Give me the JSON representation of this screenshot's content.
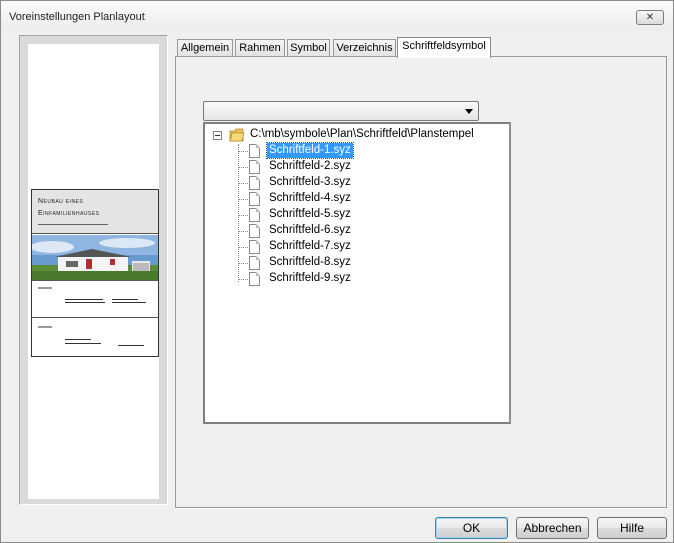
{
  "window": {
    "title": "Voreinstellungen Planlayout",
    "close_label": "✕"
  },
  "preview": {
    "stamp_title_line1": "Neubau eines",
    "stamp_title_line2": "Einfamilienhauses"
  },
  "tabs": [
    {
      "label": "Allgemein"
    },
    {
      "label": "Rahmen"
    },
    {
      "label": "Symbol"
    },
    {
      "label": "Verzeichnis"
    },
    {
      "label": "Schriftfeldsymbol",
      "active": true
    }
  ],
  "combo": {
    "value": ""
  },
  "tree": {
    "root_label": "C:\\mb\\symbole\\Plan\\Schriftfeld\\Planstempel",
    "items": [
      {
        "label": "Schriftfeld-1.syz",
        "selected": true
      },
      {
        "label": "Schriftfeld-2.syz"
      },
      {
        "label": "Schriftfeld-3.syz"
      },
      {
        "label": "Schriftfeld-4.syz"
      },
      {
        "label": "Schriftfeld-5.syz"
      },
      {
        "label": "Schriftfeld-6.syz"
      },
      {
        "label": "Schriftfeld-7.syz"
      },
      {
        "label": "Schriftfeld-8.syz"
      },
      {
        "label": "Schriftfeld-9.syz"
      }
    ]
  },
  "buttons": {
    "ok": "OK",
    "cancel": "Abbrechen",
    "help": "Hilfe"
  },
  "colors": {
    "selection": "#3399ff",
    "window_bg": "#f0f0f0"
  }
}
